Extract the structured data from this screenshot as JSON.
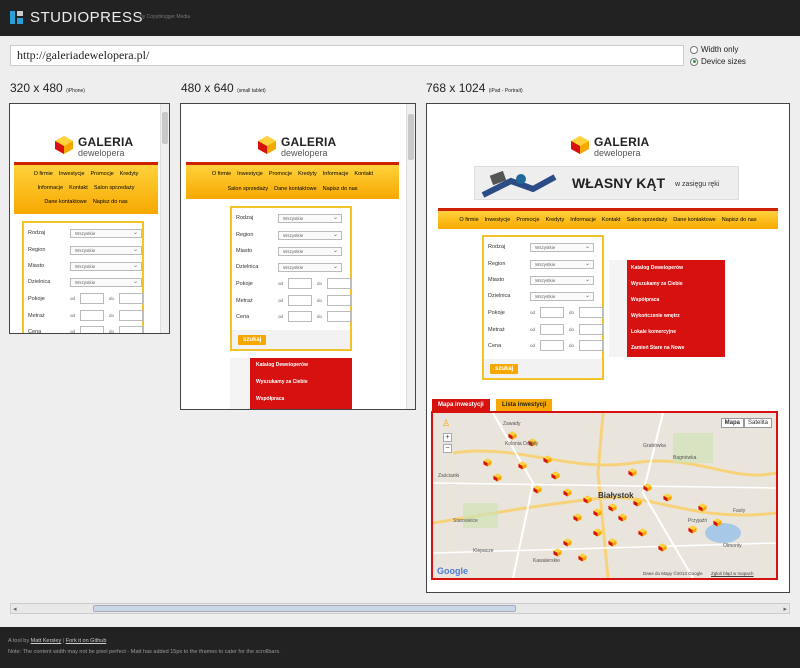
{
  "header": {
    "brand": "STUDIOPRESS",
    "byline": "by Copyblogger Media"
  },
  "url": {
    "value": "http://galeriadewelopera.pl/"
  },
  "mode": {
    "options": [
      "Width only",
      "Device sizes"
    ],
    "selected": "Device sizes"
  },
  "devices": [
    {
      "size": "320 x 480",
      "label": "(iPhone)"
    },
    {
      "size": "480 x 640",
      "label": "(small tablet)"
    },
    {
      "size": "768 x 1024",
      "label": "(iPad - Portrait)"
    }
  ],
  "site": {
    "logo_line1": "GALERIA",
    "logo_line2": "dewelopera",
    "nav": [
      "O firmie",
      "Inwestycje",
      "Promocje",
      "Kredyty",
      "Informacje",
      "Kontakt",
      "Salon sprzedaży",
      "Dane kontaktowe",
      "Napisz do nas"
    ],
    "banner_title": "WŁASNY KĄT",
    "banner_sub": "w zasięgu ręki",
    "form_labels": [
      "Rodzaj",
      "Region",
      "Miasto",
      "Dzielnica",
      "Pokoje",
      "Metraż",
      "Cena"
    ],
    "select_value": "Wszystkie",
    "from_label": "od",
    "to_label": "do",
    "search_button": "szukaj",
    "links": [
      "Katalog Deweloperów",
      "Wyszukamy za Ciebie",
      "Współpraca",
      "Wykończenie wnętrz",
      "Lokale komercyjne",
      "Zamień Stare na Nowe"
    ],
    "map_tabs": [
      "Mapa inwestycji",
      "Lista inwestycji"
    ],
    "map_types": [
      "Mapa",
      "Satelita"
    ],
    "map_places": [
      "Zawady",
      "Kolonia Dojlidy",
      "Białystok",
      "Grabówka",
      "Bagnówka",
      "Klepacze",
      "Kawalerskie",
      "Starosielce",
      "Przyjaźń",
      "Zaścianki",
      "Fasty",
      "Olmonty"
    ],
    "map_google": "Google",
    "map_credit": "Dane do Mapy ©2013 Google",
    "map_report": "Zgłoś błąd w mapach"
  },
  "footer": {
    "line1_prefix": "A tool by",
    "author": "Matt Kersley",
    "separator": "|",
    "github": "Fork it on Github",
    "note": "Note: The content width may not be pixel perfect - Matt has added 15px to the iframes to cater for the scrollbars."
  },
  "colors": {
    "accent": "#2a9fd6",
    "nav_yellow": "#f7a800",
    "red": "#d71010"
  }
}
